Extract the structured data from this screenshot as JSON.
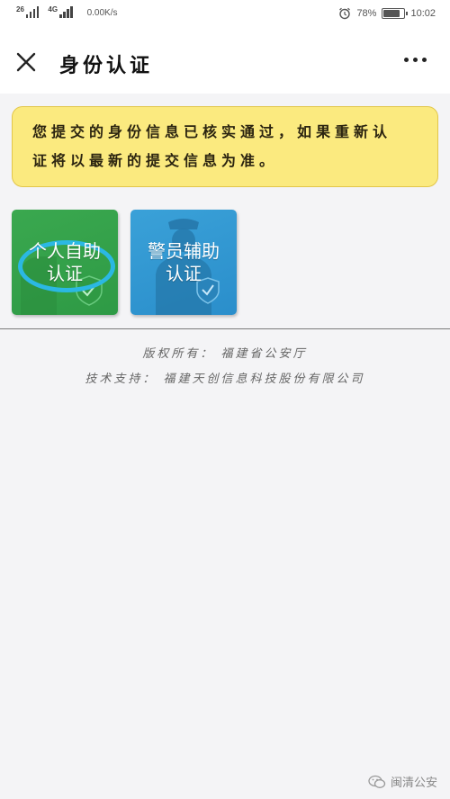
{
  "status_bar": {
    "sim1_label": "26",
    "sim2_label": "4G",
    "speed": "0.00K/s",
    "battery_percent": "78%",
    "battery_level": 0.78,
    "time": "10:02"
  },
  "nav": {
    "title": "身份认证",
    "close_icon": "close-icon",
    "more_icon": "more-icon"
  },
  "notice": {
    "line1": "您提交的身份信息已核实通过，如果重新认",
    "line2": "证将以最新的提交信息为准。"
  },
  "tiles": [
    {
      "line1": "个人自助",
      "line2": "认证",
      "color": "#34a34b",
      "icon": "person-shield-icon"
    },
    {
      "line1": "警员辅助",
      "line2": "认证",
      "color": "#339bd3",
      "icon": "police-shield-icon"
    }
  ],
  "footer": {
    "copyright": "版权所有： 福建省公安厅",
    "support": "技术支持： 福建天创信息科技股份有限公司"
  },
  "watermark": {
    "text": "闽清公安",
    "icon": "wechat-icon"
  },
  "colors": {
    "notice_bg": "#fbea7f",
    "highlight_circle": "#2bb8e3"
  }
}
